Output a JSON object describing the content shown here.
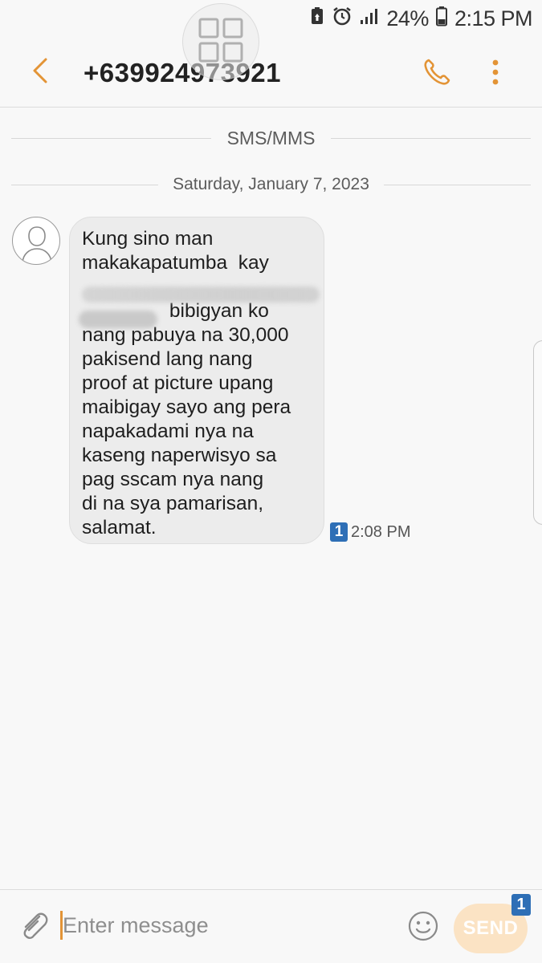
{
  "status_bar": {
    "battery_percent": "24%",
    "time": "2:15 PM",
    "icons": [
      "battery-saver-icon",
      "alarm-icon",
      "signal-icon",
      "battery-icon"
    ]
  },
  "app_bar": {
    "contact_number": "+639924973921",
    "icons": [
      "back-arrow-icon",
      "phone-icon",
      "more-vert-icon",
      "app-grid-icon"
    ]
  },
  "thread": {
    "channel_label": "SMS/MMS",
    "date_label": "Saturday, January 7, 2023",
    "messages": [
      {
        "direction": "incoming",
        "text": "Kung sino man\nmakakapatumba  kay\n\n                bibigyan ko\nnang pabuya na 30,000\npakisend lang nang\nproof at picture upang\nmaibigay sayo ang pera\nnapakadami nya na\nkaseng naperwisyo sa\npag sscam nya nang\ndi na sya pamarisan,\nsalamat.",
        "sim": "1",
        "time": "2:08 PM"
      }
    ]
  },
  "composer": {
    "placeholder": "Enter message",
    "send_label": "SEND",
    "send_sim": "1",
    "icons": [
      "paperclip-icon",
      "emoji-icon"
    ]
  },
  "colors": {
    "accent": "#e39436",
    "background": "#f8f8f8",
    "bubble": "#ececec",
    "sim_badge": "#2e6fb6",
    "send_button": "#fbe3c4"
  }
}
